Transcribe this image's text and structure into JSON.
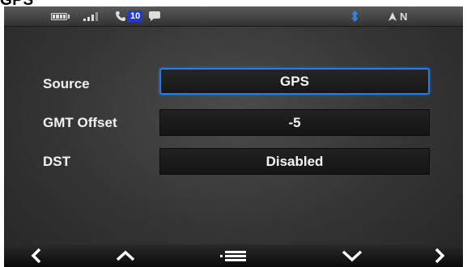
{
  "page_title": "GPS",
  "status_bar": {
    "icons": [
      "battery-icon",
      "signal-icon",
      "phone-icon",
      "message-icon",
      "bluetooth-icon",
      "compass-icon"
    ],
    "phone_badge": "10",
    "compass_label": "N",
    "colors": {
      "bluetooth": "#2a8cff",
      "badge": "#1c3ad8"
    }
  },
  "settings": [
    {
      "label": "Source",
      "value": "GPS",
      "selected": true
    },
    {
      "label": "GMT Offset",
      "value": "-5",
      "selected": false
    },
    {
      "label": "DST",
      "value": "Disabled",
      "selected": false
    }
  ],
  "nav_bar": {
    "buttons": [
      "back-icon",
      "up-icon",
      "menu-icon",
      "down-icon",
      "forward-icon"
    ]
  },
  "colors": {
    "accent": "#1e7cf0",
    "text": "#f2f2f2"
  }
}
